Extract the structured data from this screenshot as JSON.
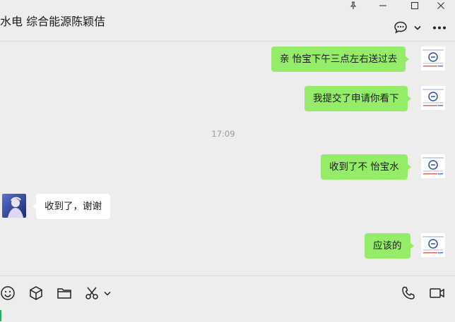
{
  "window": {
    "pin_icon": "pin-icon",
    "minimize_icon": "minimize-icon",
    "maximize_icon": "maximize-icon",
    "close_icon": "close-icon"
  },
  "header": {
    "title": "水电 综合能源陈颖佶",
    "chat_info_icon": "chat-bubble-icon",
    "dropdown_icon": "chevron-down-icon",
    "more_icon": "more-icon"
  },
  "messages": [
    {
      "side": "out",
      "text": "亲 怡宝下午三点左右送过去"
    },
    {
      "side": "out",
      "text": "我提交了申请你看下"
    },
    {
      "type": "time",
      "text": "17:09"
    },
    {
      "side": "out",
      "text": "收到了不 怡宝水"
    },
    {
      "side": "in",
      "text": "收到了，谢谢"
    },
    {
      "side": "out",
      "text": "应该的"
    }
  ],
  "toolbar": {
    "emoji_icon": "emoji-icon",
    "favorites_icon": "box-icon",
    "file_icon": "folder-icon",
    "screenshot_icon": "scissors-icon",
    "screenshot_menu_icon": "chevron-down-icon",
    "voice_call_icon": "phone-icon",
    "video_call_icon": "video-icon"
  },
  "colors": {
    "background": "#ededed",
    "outgoing_bubble": "#95ec69",
    "incoming_bubble": "#ffffff",
    "caret": "#07c160"
  }
}
